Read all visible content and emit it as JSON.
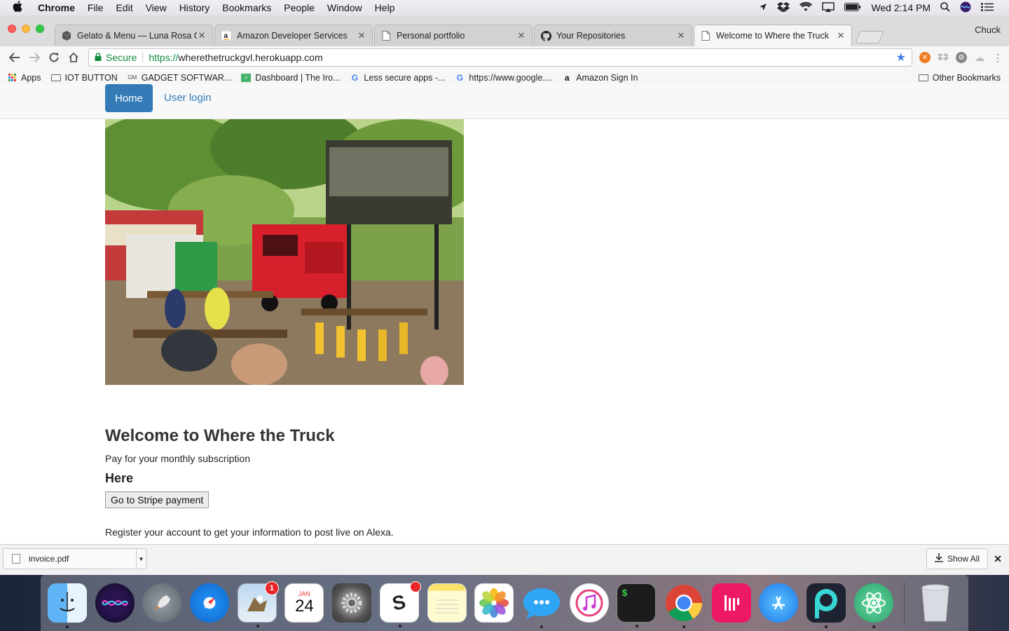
{
  "menubar": {
    "app": "Chrome",
    "items": [
      "File",
      "Edit",
      "View",
      "History",
      "Bookmarks",
      "People",
      "Window",
      "Help"
    ],
    "clock": "Wed 2:14 PM"
  },
  "window": {
    "profile": "Chuck",
    "tabs": [
      {
        "label": "Gelato & Menu — Luna Rosa G",
        "icon": "cube-icon"
      },
      {
        "label": "Amazon Developer Services",
        "icon": "amazon-icon"
      },
      {
        "label": "Personal portfolio",
        "icon": "page-icon"
      },
      {
        "label": "Your Repositories",
        "icon": "github-icon"
      },
      {
        "label": "Welcome to Where the Truck",
        "icon": "page-icon",
        "active": true
      }
    ]
  },
  "omnibox": {
    "secure_label": "Secure",
    "scheme": "https://",
    "host": "wherethetruckgvl.herokuapp.com"
  },
  "bookmarks": {
    "items": [
      "Apps",
      "IOT BUTTON",
      "GADGET SOFTWAR...",
      "Dashboard | The Iro...",
      "Less secure apps -...",
      "https://www.google....",
      "Amazon Sign In"
    ],
    "other": "Other Bookmarks"
  },
  "site": {
    "nav": {
      "home": "Home",
      "login": "User login"
    },
    "heading": "Welcome to Where the Truck",
    "subscription_text": "Pay for your monthly subscription",
    "here": "Here",
    "stripe_button": "Go to Stripe payment",
    "register_text": "Register your account to get your information to post live on Alexa."
  },
  "downloads": {
    "file": "invoice.pdf",
    "show_all": "Show All"
  },
  "dock": {
    "apps": [
      "Finder",
      "Siri",
      "Launchpad",
      "Safari",
      "Mail",
      "Calendar",
      "System Preferences",
      "Slack",
      "Notes",
      "Photos",
      "Messages",
      "iTunes",
      "Terminal",
      "Chrome",
      "Gitter",
      "App Store",
      "Periscope",
      "Atom",
      "Trash"
    ],
    "calendar_month": "JAN",
    "calendar_day": "24",
    "mail_badge": "1",
    "terminal_prompt": "$"
  },
  "colors": {
    "primary": "#337ab7",
    "secure_green": "#128a3f",
    "star_blue": "#3d7fe6"
  }
}
